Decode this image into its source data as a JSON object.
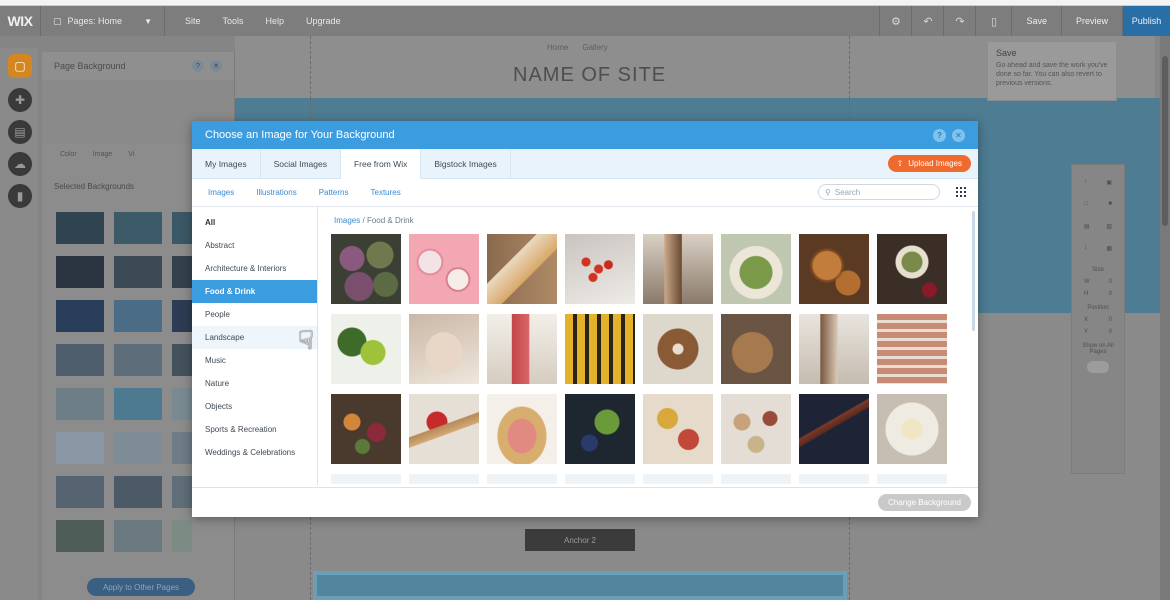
{
  "topbar": {
    "logo": "WIX",
    "pages_label": "Pages: Home",
    "menu": [
      "Site",
      "Tools",
      "Help",
      "Upgrade"
    ],
    "save": "Save",
    "preview": "Preview",
    "publish": "Publish"
  },
  "site": {
    "nav": [
      "Home",
      "Gallery"
    ],
    "title": "NAME OF SITE",
    "anchor": "Anchor 2"
  },
  "save_tooltip": {
    "title": "Save",
    "body": "Go ahead and save the work you've done so far. You can also revert to previous versions."
  },
  "bg_panel": {
    "title": "Page Background",
    "tabs": [
      "Color",
      "Image",
      "Vi"
    ],
    "section": "Selected Backgrounds",
    "apply": "Apply to Other Pages"
  },
  "right_toolbar": {
    "size": "Size",
    "w": "W",
    "h": "H",
    "position": "Position",
    "x": "X",
    "y": "Y",
    "show_all": "Show on All Pages"
  },
  "modal": {
    "title": "Choose an Image for Your Background",
    "tabs": [
      "My Images",
      "Social Images",
      "Free from Wix",
      "Bigstock Images"
    ],
    "upload": "Upload Images",
    "subtabs": [
      "Images",
      "Illustrations",
      "Patterns",
      "Textures"
    ],
    "search_placeholder": "Search",
    "categories": [
      "All",
      "Abstract",
      "Architecture & Interiors",
      "Food & Drink",
      "People",
      "Landscape",
      "Music",
      "Nature",
      "Objects",
      "Sports & Recreation",
      "Weddings & Celebrations"
    ],
    "breadcrumb_root": "Images",
    "breadcrumb_sep": "/",
    "breadcrumb_current": "Food & Drink",
    "change_button": "Change Background"
  },
  "colors": {
    "accent": "#3b9de0",
    "upload": "#ef6a2e",
    "editor_bar": "#7d7d7d"
  }
}
